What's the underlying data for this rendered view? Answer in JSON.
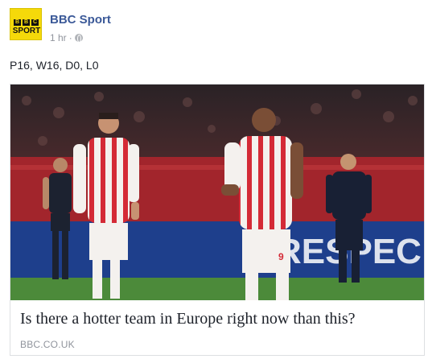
{
  "post": {
    "page_name": "BBC Sport",
    "timestamp": "1 hr",
    "separator": "·",
    "privacy_icon": "globe-icon",
    "text": "P16, W16, D0, L0"
  },
  "avatar": {
    "logo_letters": [
      "B",
      "B",
      "C"
    ],
    "logo_word": "SPORT",
    "bg_color": "#f5d90a"
  },
  "link_preview": {
    "title": "Is there a hotter team in Europe right now than this?",
    "domain": "BBC.CO.UK"
  },
  "colors": {
    "page_name": "#3b5998",
    "meta_text": "#90949c",
    "body_text": "#1d2129",
    "border": "#dddfe2",
    "kit_red": "#d42a36"
  }
}
